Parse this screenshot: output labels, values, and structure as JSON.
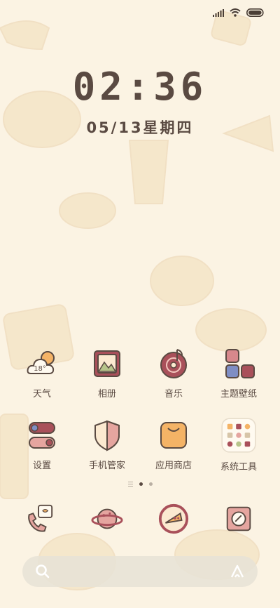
{
  "status": {
    "signal_icon": "signal-icon",
    "wifi_icon": "wifi-icon",
    "battery_icon": "battery-icon"
  },
  "lockscreen": {
    "time": "02:36",
    "date": "05/13星期四"
  },
  "apps": [
    {
      "label": "天气",
      "icon": "weather-icon",
      "temp": "18°"
    },
    {
      "label": "相册",
      "icon": "gallery-icon"
    },
    {
      "label": "音乐",
      "icon": "music-icon"
    },
    {
      "label": "主题壁纸",
      "icon": "themes-icon"
    },
    {
      "label": "设置",
      "icon": "settings-icon"
    },
    {
      "label": "手机管家",
      "icon": "security-icon"
    },
    {
      "label": "应用商店",
      "icon": "app-store-icon"
    },
    {
      "label": "系统工具",
      "icon": "tools-folder-icon"
    }
  ],
  "page_indicator": {
    "pages": 2,
    "current": 1
  },
  "dock": [
    {
      "icon": "phone-icon"
    },
    {
      "icon": "browser-planet-icon"
    },
    {
      "icon": "pizza-food-icon"
    },
    {
      "icon": "camera-icon"
    }
  ],
  "search": {
    "left_icon": "search-icon",
    "right_icon": "assistant-icon"
  },
  "colors": {
    "background": "#fbf3e3",
    "text": "#5a4a42",
    "accent_maroon": "#a9505a",
    "accent_orange": "#f4b366"
  }
}
